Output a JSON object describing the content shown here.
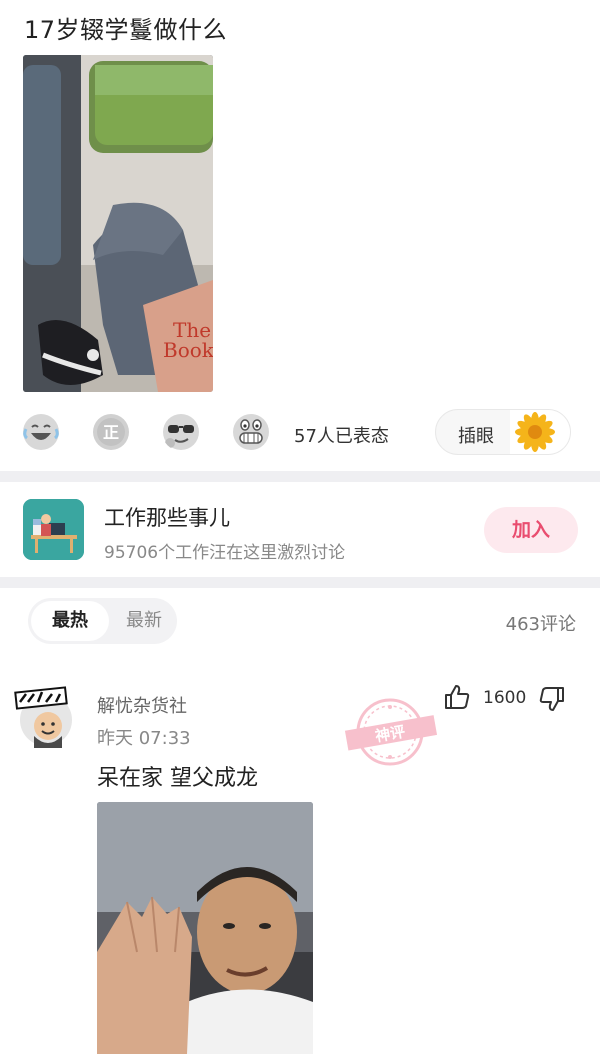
{
  "post": {
    "title": "17岁辍学鬘做什么"
  },
  "reactions": {
    "emoji_icons": [
      "laughing-tears-icon",
      "zheng-badge-icon",
      "sunglasses-face-icon",
      "grinning-face-icon"
    ],
    "count_text": "57人已表态",
    "express_label": "插眼",
    "flower_icon": "sunflower-icon"
  },
  "group": {
    "name": "工作那些事儿",
    "description": "95706个工作汪在这里激烈讨论",
    "join_label": "加入"
  },
  "comments_header": {
    "tabs": [
      "最热",
      "最新"
    ],
    "active_tab": "最热",
    "count_text": "463评论"
  },
  "comment": {
    "author": "解忧杂货社",
    "time": "昨天 07:33",
    "text": "呆在家 望父成龙",
    "likes": "1600",
    "stamp_text": "神评"
  },
  "colors": {
    "accent_pink": "#e94d6f",
    "divider": "#efeff2",
    "group_avatar_bg": "#3aa6a0"
  }
}
